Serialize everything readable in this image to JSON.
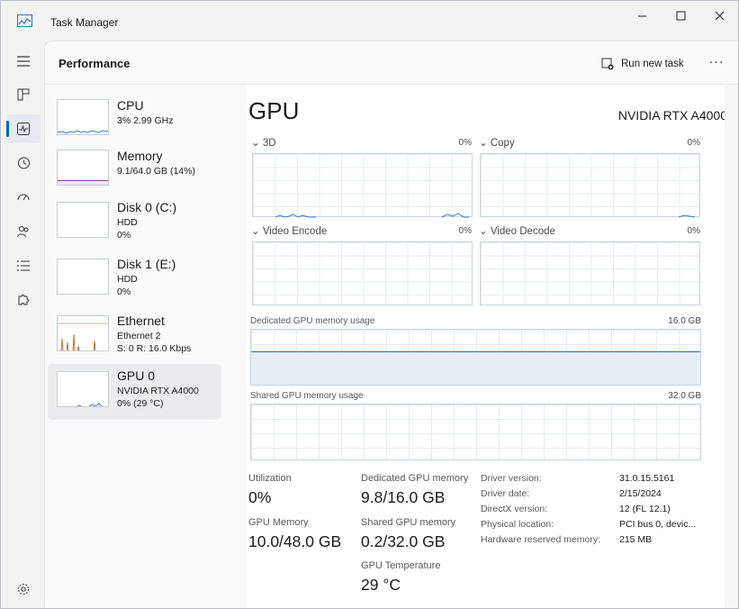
{
  "window": {
    "title": "Task Manager"
  },
  "header": {
    "title": "Performance",
    "run_task": "Run new task",
    "more": "···"
  },
  "sidebar": {
    "items": [
      "menu",
      "processes",
      "performance",
      "app-history",
      "startup-apps",
      "users",
      "details",
      "services"
    ],
    "active": "performance"
  },
  "devices": [
    {
      "name": "CPU",
      "line2": "3% 2.99 GHz",
      "line3": ""
    },
    {
      "name": "Memory",
      "line2": "9.1/64.0 GB (14%)",
      "line3": ""
    },
    {
      "name": "Disk 0 (C:)",
      "line2": "HDD",
      "line3": "0%"
    },
    {
      "name": "Disk 1 (E:)",
      "line2": "HDD",
      "line3": "0%"
    },
    {
      "name": "Ethernet",
      "line2": "Ethernet 2",
      "line3": "S: 0 R: 16.0 Kbps"
    },
    {
      "name": "GPU 0",
      "line2": "NVIDIA RTX A4000",
      "line3": "0% (29 °C)"
    }
  ],
  "gpu": {
    "title": "GPU",
    "model": "NVIDIA RTX A4000",
    "engines": [
      {
        "label": "3D",
        "pct": "0%"
      },
      {
        "label": "Copy",
        "pct": "0%"
      },
      {
        "label": "Video Encode",
        "pct": "0%"
      },
      {
        "label": "Video Decode",
        "pct": "0%"
      }
    ],
    "dedicated": {
      "label": "Dedicated GPU memory usage",
      "max": "16.0 GB",
      "fill": 0.6
    },
    "shared": {
      "label": "Shared GPU memory usage",
      "max": "32.0 GB",
      "fill": 0.0
    },
    "stats": {
      "utilization_label": "Utilization",
      "utilization": "0%",
      "gpu_memory_label": "GPU Memory",
      "gpu_memory": "10.0/48.0 GB",
      "dedicated_label": "Dedicated GPU memory",
      "dedicated": "9.8/16.0 GB",
      "shared_label": "Shared GPU memory",
      "shared": "0.2/32.0 GB",
      "temp_label": "GPU Temperature",
      "temp": "29 °C"
    },
    "info": [
      {
        "key": "Driver version:",
        "value": "31.0.15.5161"
      },
      {
        "key": "Driver date:",
        "value": "2/15/2024"
      },
      {
        "key": "DirectX version:",
        "value": "12 (FL 12.1)"
      },
      {
        "key": "Physical location:",
        "value": "PCI bus 0, devic..."
      },
      {
        "key": "Hardware reserved memory:",
        "value": "215 MB"
      }
    ]
  },
  "colors": {
    "accent": "#0067c0",
    "cpu": "#2f7ed8",
    "memory": "#8e3fb4",
    "ethernet": "#c55a11",
    "gpu": "#2f7ed8"
  }
}
